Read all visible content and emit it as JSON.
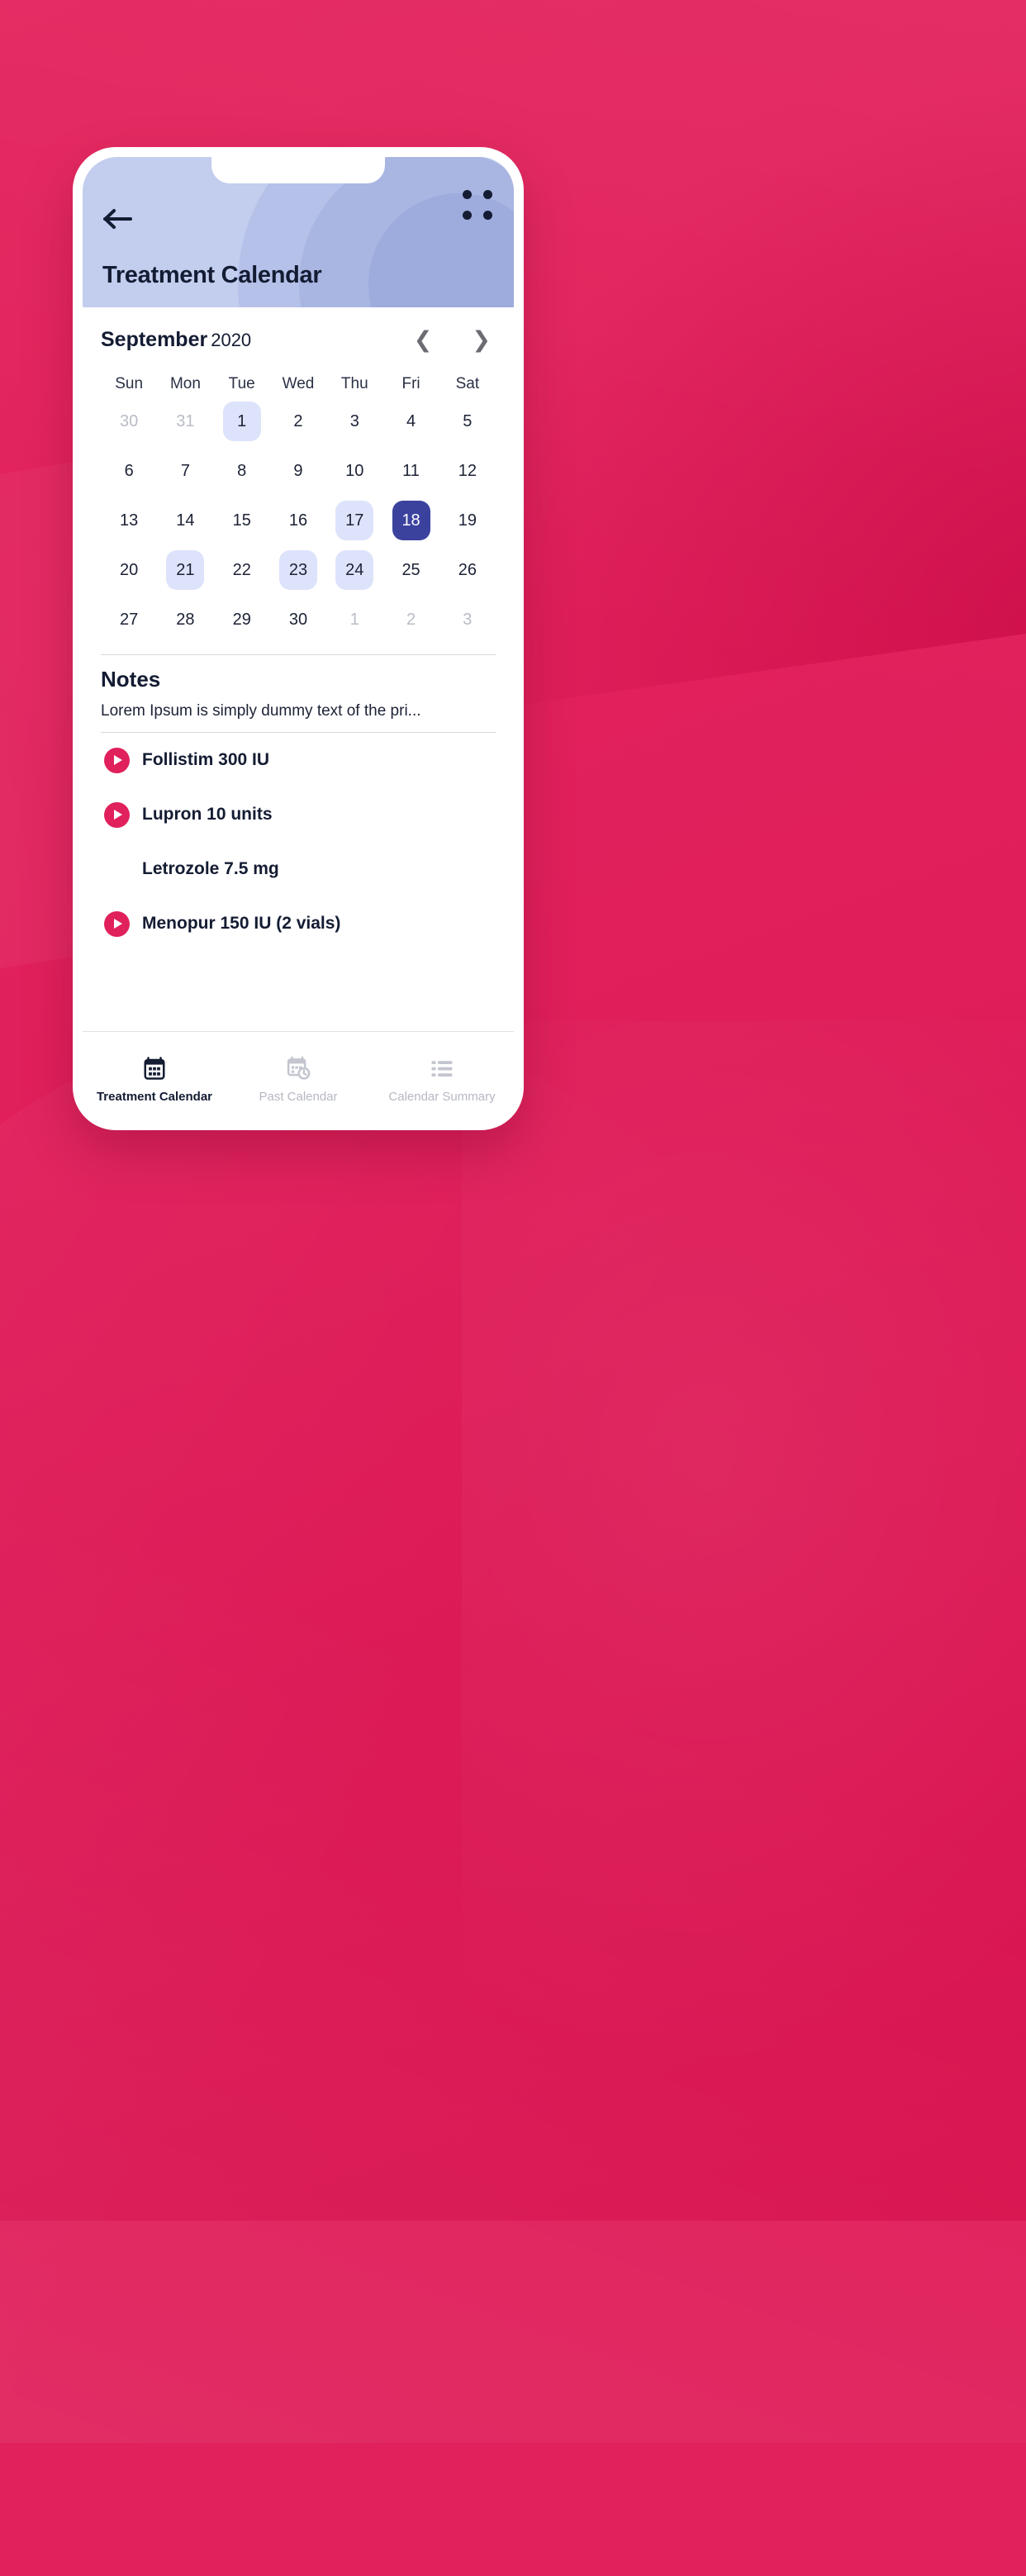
{
  "header": {
    "title": "Treatment Calendar",
    "back_icon": "arrow-left-icon",
    "menu_icon": "grid-dots-icon"
  },
  "calendar": {
    "month": "September",
    "year": "2020",
    "prev_icon": "chevron-left-icon",
    "next_icon": "chevron-right-icon",
    "weekdays": [
      "Sun",
      "Mon",
      "Tue",
      "Wed",
      "Thu",
      "Fri",
      "Sat"
    ],
    "weeks": [
      [
        {
          "d": "30",
          "state": "muted"
        },
        {
          "d": "31",
          "state": "muted"
        },
        {
          "d": "1",
          "state": "mark"
        },
        {
          "d": "2",
          "state": "normal"
        },
        {
          "d": "3",
          "state": "normal"
        },
        {
          "d": "4",
          "state": "normal"
        },
        {
          "d": "5",
          "state": "normal"
        }
      ],
      [
        {
          "d": "6",
          "state": "normal"
        },
        {
          "d": "7",
          "state": "normal"
        },
        {
          "d": "8",
          "state": "normal"
        },
        {
          "d": "9",
          "state": "normal"
        },
        {
          "d": "10",
          "state": "normal"
        },
        {
          "d": "11",
          "state": "normal"
        },
        {
          "d": "12",
          "state": "normal"
        }
      ],
      [
        {
          "d": "13",
          "state": "normal"
        },
        {
          "d": "14",
          "state": "normal"
        },
        {
          "d": "15",
          "state": "normal"
        },
        {
          "d": "16",
          "state": "normal"
        },
        {
          "d": "17",
          "state": "mark"
        },
        {
          "d": "18",
          "state": "sel"
        },
        {
          "d": "19",
          "state": "normal"
        }
      ],
      [
        {
          "d": "20",
          "state": "normal"
        },
        {
          "d": "21",
          "state": "mark"
        },
        {
          "d": "22",
          "state": "normal"
        },
        {
          "d": "23",
          "state": "mark"
        },
        {
          "d": "24",
          "state": "mark"
        },
        {
          "d": "25",
          "state": "normal"
        },
        {
          "d": "26",
          "state": "normal"
        }
      ],
      [
        {
          "d": "27",
          "state": "normal"
        },
        {
          "d": "28",
          "state": "normal"
        },
        {
          "d": "29",
          "state": "normal"
        },
        {
          "d": "30",
          "state": "normal"
        },
        {
          "d": "1",
          "state": "muted"
        },
        {
          "d": "2",
          "state": "muted"
        },
        {
          "d": "3",
          "state": "muted"
        }
      ]
    ],
    "selected_day": "18",
    "marked_days": [
      "1",
      "17",
      "21",
      "23",
      "24"
    ]
  },
  "notes": {
    "heading": "Notes",
    "body": "Lorem Ipsum is simply dummy text of the pri..."
  },
  "medications": [
    {
      "name": "Follistim 300 IU",
      "has_play": true
    },
    {
      "name": "Lupron 10 units",
      "has_play": true
    },
    {
      "name": "Letrozole 7.5 mg",
      "has_play": false
    },
    {
      "name": "Menopur 150 IU (2 vials)",
      "has_play": true
    }
  ],
  "bottom_nav": [
    {
      "label": "Treatment Calendar",
      "icon": "calendar-icon",
      "active": true
    },
    {
      "label": "Past Calendar",
      "icon": "calendar-clock-icon",
      "active": false
    },
    {
      "label": "Calendar Summary",
      "icon": "list-icon",
      "active": false
    }
  ],
  "colors": {
    "background_pink": "#e0215c",
    "header_blue": "#c3cdee",
    "selected_day": "#3b429e",
    "marked_day": "#dde3fb",
    "text_dark": "#141c33",
    "text_muted": "#b6b8c2"
  }
}
